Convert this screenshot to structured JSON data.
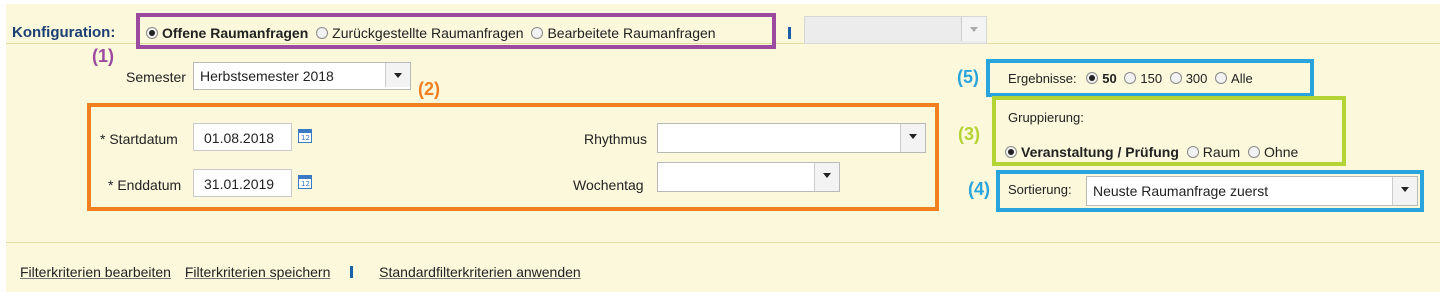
{
  "config": {
    "label": "Konfiguration:",
    "options": [
      "Offene Raumanfragen",
      "Zurückgestellte Raumanfragen",
      "Bearbeitete Raumanfragen"
    ],
    "selected": 0
  },
  "annotations": [
    "(1)",
    "(2)",
    "(3)",
    "(4)",
    "(5)"
  ],
  "annotation_colors": {
    "1": "#9b4aa0",
    "2": "#f07f1f",
    "3": "#b4d334",
    "4": "#29a4dd",
    "5": "#29a4dd"
  },
  "semester": {
    "label": "Semester",
    "value": "Herbstsemester 2018"
  },
  "dates": {
    "start_label": "* Startdatum",
    "start_value": "01.08.2018",
    "end_label": "* Enddatum",
    "end_value": "31.01.2019",
    "calendar_icon_text": "12"
  },
  "rhythmus": {
    "label": "Rhythmus",
    "value": ""
  },
  "wochentag": {
    "label": "Wochentag",
    "value": ""
  },
  "ergebnisse": {
    "label": "Ergebnisse:",
    "options": [
      "50",
      "150",
      "300",
      "Alle"
    ],
    "selected": 0
  },
  "gruppierung": {
    "label": "Gruppierung:",
    "options": [
      "Veranstaltung / Prüfung",
      "Raum",
      "Ohne"
    ],
    "selected": 0
  },
  "sortierung": {
    "label": "Sortierung:",
    "value": "Neuste Raumanfrage zuerst"
  },
  "footer": {
    "edit_filters": "Filterkriterien bearbeiten",
    "save_filters": "Filterkriterien speichern",
    "apply_default": "Standardfilterkriterien anwenden"
  }
}
